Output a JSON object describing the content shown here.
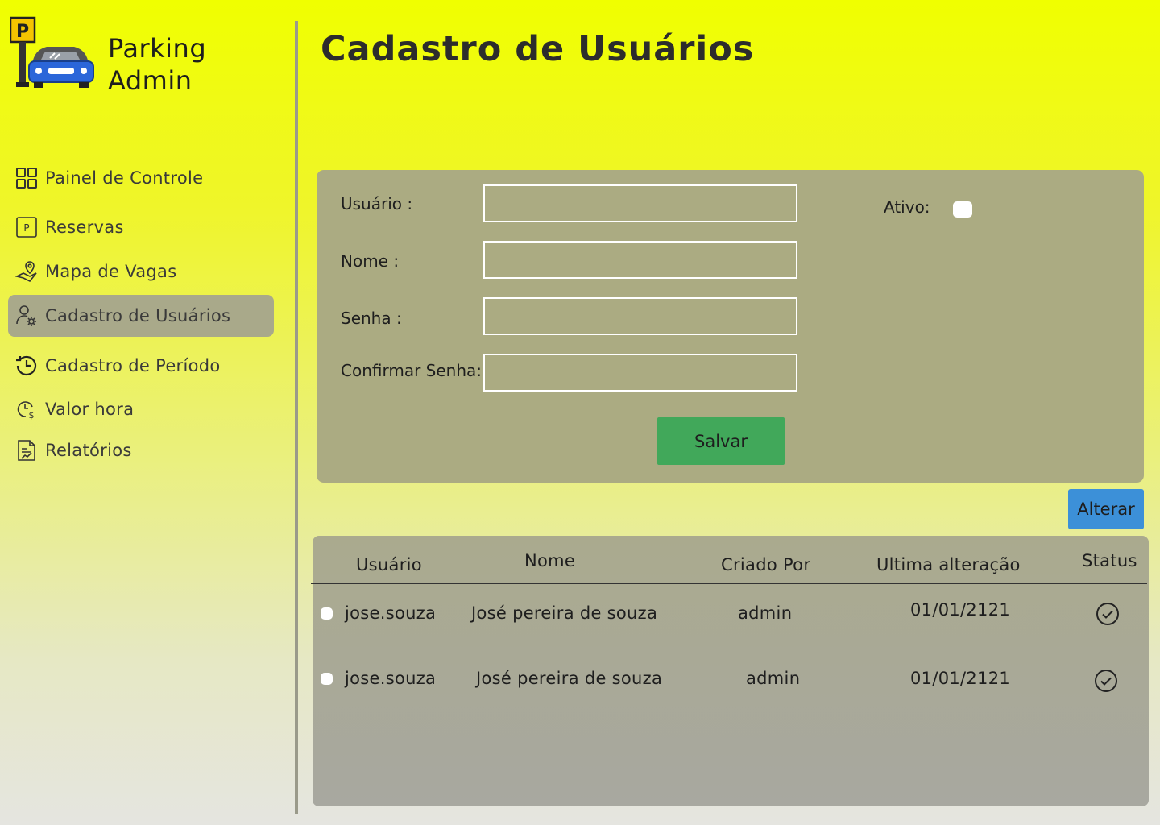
{
  "brand": {
    "line1": "Parking",
    "line2": "Admin"
  },
  "sidebar": {
    "items": [
      {
        "label": "Painel de Controle",
        "icon": "dashboard-grid-icon"
      },
      {
        "label": "Reservas",
        "icon": "parking-sign-icon"
      },
      {
        "label": "Mapa de Vagas",
        "icon": "map-pin-icon"
      },
      {
        "label": "Cadastro de Usuários",
        "icon": "user-settings-icon",
        "active": true
      },
      {
        "label": "Cadastro de Período",
        "icon": "clock-history-icon"
      },
      {
        "label": "Valor hora",
        "icon": "clock-dollar-icon"
      },
      {
        "label": "Relatórios",
        "icon": "report-chart-icon"
      }
    ]
  },
  "page": {
    "title": "Cadastro de Usuários"
  },
  "form": {
    "usuario_label": "Usuário :",
    "nome_label": "Nome :",
    "senha_label": "Senha :",
    "confirmar_label": "Confirmar Senha:",
    "ativo_label": "Ativo:",
    "usuario_value": "",
    "nome_value": "",
    "senha_value": "",
    "confirmar_value": "",
    "save_label": "Salvar"
  },
  "actions": {
    "alterar_label": "Alterar"
  },
  "table": {
    "headers": [
      "Usuário",
      "Nome",
      "Criado Por",
      "Ultima alteração",
      "Status"
    ],
    "rows": [
      {
        "usuario": "jose.souza",
        "nome": "José pereira de souza",
        "criado_por": "admin",
        "ultima_alteracao": "01/01/2121",
        "status": "check-circle-icon"
      },
      {
        "usuario": "jose.souza",
        "nome": "José pereira de souza",
        "criado_por": "admin",
        "ultima_alteracao": "01/01/2121",
        "status": "check-circle-icon"
      }
    ]
  },
  "colors": {
    "accent_active": "#a9a98a",
    "save_button": "#41a85a",
    "alter_button": "#3c90d8",
    "panel": "#abab82"
  }
}
